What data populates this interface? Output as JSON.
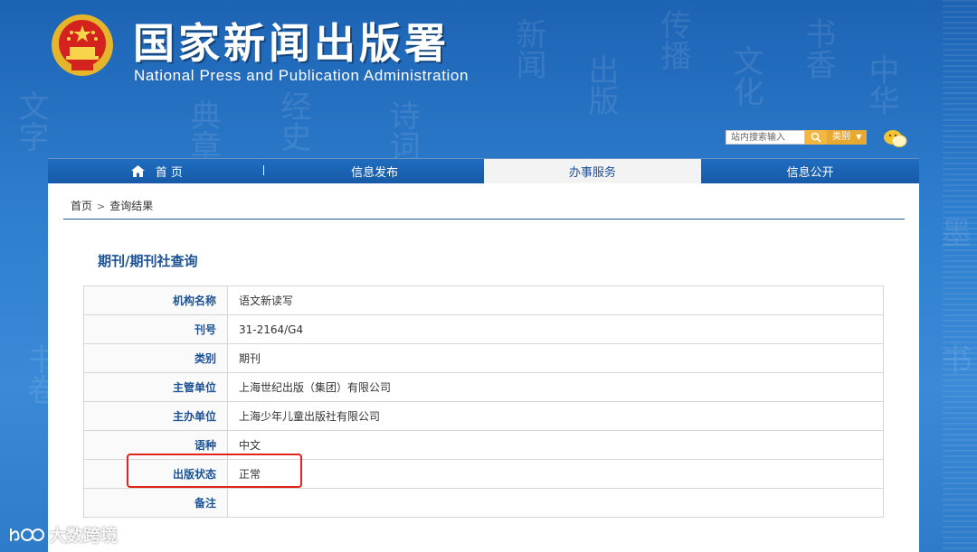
{
  "header": {
    "title_cn": "国家新闻出版署",
    "title_en": "National  Press and Publication Administration"
  },
  "search": {
    "placeholder": "站内搜索输入",
    "category_label": "类别"
  },
  "nav": {
    "items": [
      {
        "label": "首 页",
        "icon": "home-icon"
      },
      {
        "label": "信息发布"
      },
      {
        "label": "办事服务",
        "active": true
      },
      {
        "label": "信息公开"
      }
    ]
  },
  "breadcrumb": {
    "home": "首页",
    "separator": ">",
    "current": "查询结果"
  },
  "page": {
    "section_title": "期刊/期刊社查询"
  },
  "info_table": {
    "rows": [
      {
        "label": "机构名称",
        "value": "语文新读写"
      },
      {
        "label": "刊号",
        "value": "31-2164/G4"
      },
      {
        "label": "类别",
        "value": "期刊"
      },
      {
        "label": "主管单位",
        "value": "上海世纪出版（集团）有限公司"
      },
      {
        "label": "主办单位",
        "value": "上海少年儿童出版社有限公司"
      },
      {
        "label": "语种",
        "value": "中文"
      },
      {
        "label": "出版状态",
        "value": "正常"
      },
      {
        "label": "备注",
        "value": ""
      }
    ]
  },
  "watermark": {
    "text": "大数跨境"
  },
  "colors": {
    "accent_blue": "#1d5294",
    "highlight_red": "#e0231b",
    "search_orange": "#f1b73e"
  }
}
